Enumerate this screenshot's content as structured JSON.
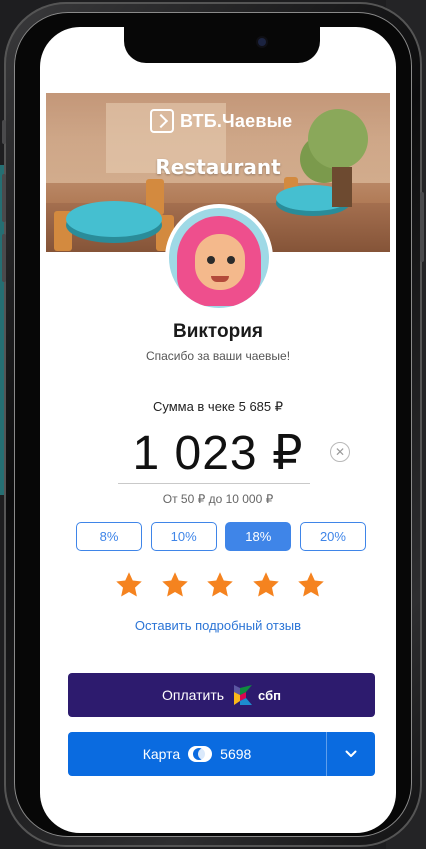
{
  "banner": {
    "brand_name": "ВТБ.Чаевые",
    "venue_name": "Restaurant"
  },
  "profile": {
    "name": "Виктория",
    "thanks_text": "Спасибо за ваши чаевые!"
  },
  "tip": {
    "check_sum_text": "Сумма в чеке 5 685 ₽",
    "amount_text": "1 023 ₽",
    "range_text": "От 50 ₽ до 10 000 ₽",
    "clear_icon": "close-icon",
    "percent_options": [
      "8%",
      "10%",
      "18%",
      "20%"
    ],
    "selected_percent": "18%"
  },
  "rating": {
    "stars": 5,
    "max_stars": 5,
    "star_color": "#f5831f",
    "feedback_link": "Оставить подробный отзыв"
  },
  "pay": {
    "label": "Оплатить",
    "method": "сбп"
  },
  "card": {
    "label": "Карта",
    "last_digits": "5698",
    "dropdown_icon": "chevron-down-icon"
  },
  "colors": {
    "accent": "#3f85e8",
    "pay_button": "#2d1b6e",
    "card_button": "#0a6be0",
    "link": "#2c75d6"
  }
}
